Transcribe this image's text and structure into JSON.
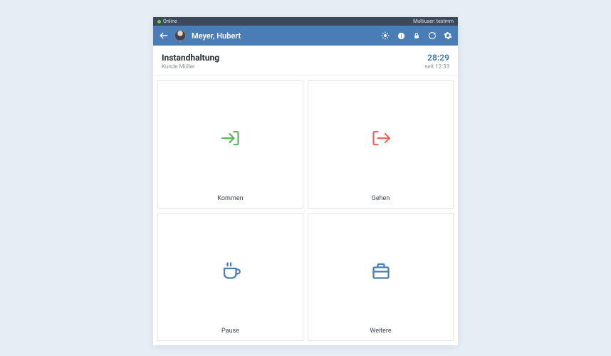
{
  "statusbar": {
    "connection": "Online",
    "multiuser": "Multiuser: testmm"
  },
  "appbar": {
    "user_name": "Meyer, Hubert"
  },
  "header": {
    "title": "Instandhaltung",
    "subtitle": "Kunde Müller",
    "timer": "28:29",
    "since": "seit 12:33"
  },
  "tiles": {
    "come": {
      "label": "Kommen"
    },
    "go": {
      "label": "Gehen"
    },
    "pause": {
      "label": "Pause"
    },
    "more": {
      "label": "Weitere"
    }
  },
  "colors": {
    "accent": "#4a7db5",
    "come": "#62b564",
    "go": "#e86a63",
    "pause": "#4a7db5",
    "more": "#4a7db5"
  }
}
